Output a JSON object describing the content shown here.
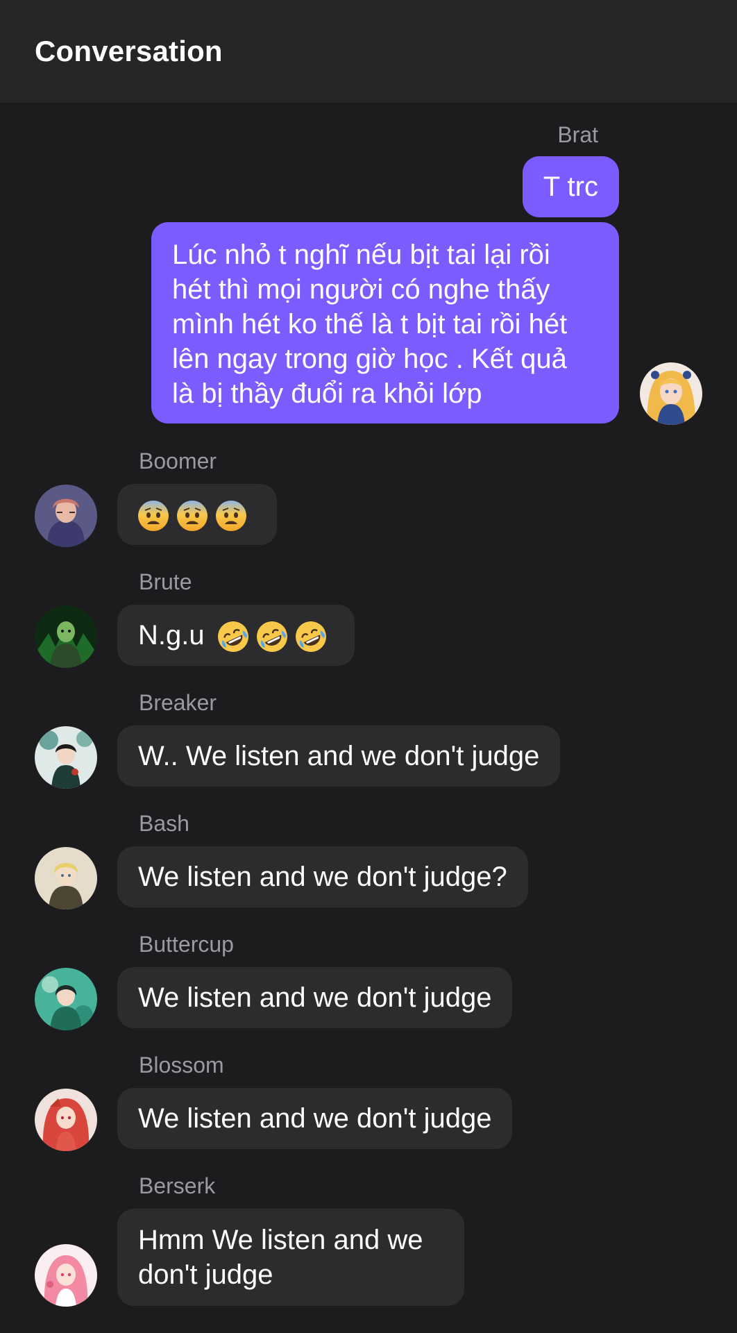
{
  "header": {
    "title": "Conversation"
  },
  "messages": [
    {
      "sender": "Brat",
      "direction": "outgoing",
      "bubbles": [
        {
          "text": "T trc"
        },
        {
          "lines": [
            "Lúc nhỏ t nghĩ nếu bịt tai lại rồi",
            "hét thì mọi người có nghe thấy",
            "mình hét ko thế là t bịt tai rồi hét",
            "lên ngay trong giờ học . Kết quả",
            "là bị thầy đuổi ra khỏi lớp"
          ]
        }
      ],
      "avatar_icon": "avatar-blonde-girl-icon"
    },
    {
      "sender": "Boomer",
      "direction": "incoming",
      "text": "",
      "emoji": [
        "fearful-face",
        "fearful-face",
        "fearful-face"
      ],
      "avatar_icon": "avatar-boomer-icon"
    },
    {
      "sender": "Brute",
      "direction": "incoming",
      "text": "N.g.u",
      "emoji": [
        "rolling-laughing-face",
        "rolling-laughing-face",
        "rolling-laughing-face"
      ],
      "avatar_icon": "avatar-brute-icon"
    },
    {
      "sender": "Breaker",
      "direction": "incoming",
      "text": "W.. We listen and we don't judge",
      "avatar_icon": "avatar-breaker-icon"
    },
    {
      "sender": "Bash",
      "direction": "incoming",
      "text": "We listen and we don't judge?",
      "avatar_icon": "avatar-bash-icon"
    },
    {
      "sender": "Buttercup",
      "direction": "incoming",
      "text": "We listen and we don't judge",
      "avatar_icon": "avatar-buttercup-icon"
    },
    {
      "sender": "Blossom",
      "direction": "incoming",
      "text": "We listen and we don't judge",
      "avatar_icon": "avatar-blossom-icon"
    },
    {
      "sender": "Berserk",
      "direction": "incoming",
      "lines": [
        "Hmm We listen and we",
        "don't judge"
      ],
      "avatar_icon": "avatar-berserk-icon"
    }
  ],
  "colors": {
    "background": "#1c1c1e",
    "header": "#262628",
    "outgoing_bubble": "#7b5cff",
    "incoming_bubble": "#2c2c2e",
    "sender_name": "#9a9a9f"
  }
}
